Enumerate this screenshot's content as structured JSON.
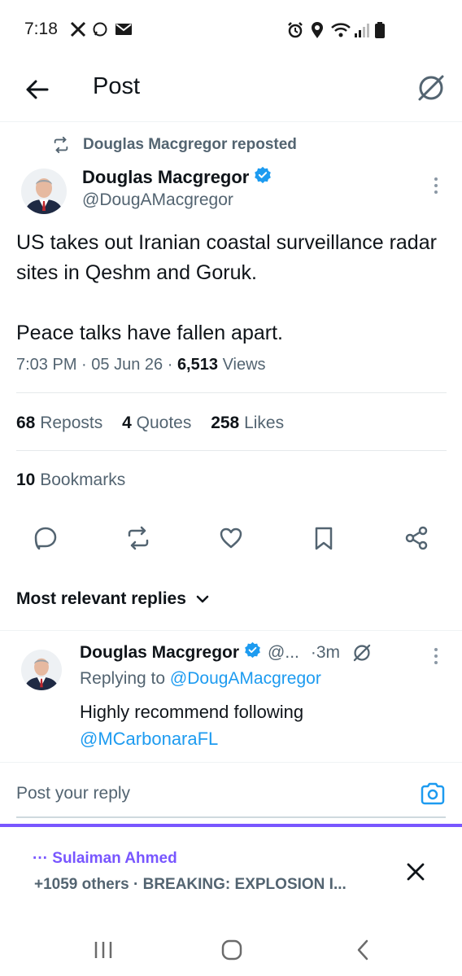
{
  "status_bar": {
    "time": "7:18",
    "left_icons": [
      "x-logo-icon",
      "messenger-icon",
      "mail-icon"
    ],
    "right_icons": [
      "alarm-icon",
      "location-icon",
      "wifi-icon",
      "signal-icon",
      "battery-icon"
    ]
  },
  "header": {
    "title": "Post"
  },
  "post": {
    "repost_label": "Douglas Macgregor reposted",
    "author_name": "Douglas Macgregor",
    "author_handle": "@DougAMacgregor",
    "text_line1": "US takes out Iranian coastal surveillance radar sites in Qeshm and Goruk.",
    "text_line2": "Peace talks have fallen apart.",
    "time": "7:03 PM",
    "date": "05 Jun 26",
    "views_count": "6,513",
    "views_label": "Views",
    "separator": "·"
  },
  "stats": {
    "reposts_count": "68",
    "reposts_label": "Reposts",
    "quotes_count": "4",
    "quotes_label": "Quotes",
    "likes_count": "258",
    "likes_label": "Likes",
    "bookmarks_count": "10",
    "bookmarks_label": "Bookmarks"
  },
  "replies_sort": {
    "label": "Most relevant replies"
  },
  "reply": {
    "author_name": "Douglas Macgregor",
    "author_handle": "@...",
    "time": "·3m",
    "replying_prefix": "Replying to",
    "replying_handle": "@DougAMacgregor",
    "text": "Highly recommend following",
    "mention": "@MCarbonaraFL"
  },
  "compose": {
    "placeholder": "Post your reply"
  },
  "notification": {
    "ellipsis": "···",
    "user": "Sulaiman Ahmed",
    "text": "+1059 others · BREAKING: EXPLOSION I..."
  },
  "colors": {
    "accent": "#1d9bf0",
    "notification_accent": "#7856ff",
    "secondary_text": "#536471"
  }
}
